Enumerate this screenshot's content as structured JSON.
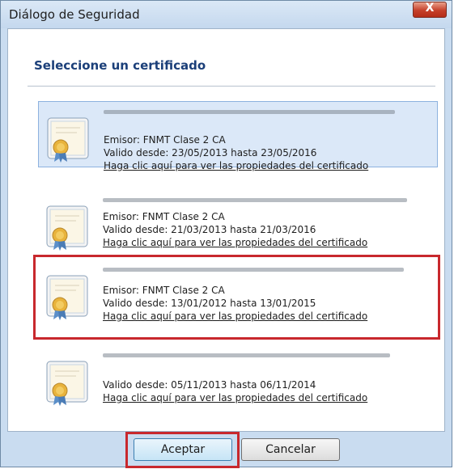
{
  "window": {
    "title": "Diálogo de Seguridad",
    "close_label": "X"
  },
  "header": {
    "title": "Seleccione un certificado"
  },
  "certificates": [
    {
      "issuer": "Emisor: FNMT Clase 2 CA",
      "validity": "Valido desde: 23/05/2013 hasta 23/05/2016",
      "link": "Haga clic aquí para ver las propiedades del certificado",
      "selected": true
    },
    {
      "issuer": "Emisor: FNMT Clase 2 CA",
      "validity": "Valido desde: 21/03/2013 hasta 21/03/2016",
      "link": "Haga clic aquí para ver las propiedades del certificado",
      "selected": false
    },
    {
      "issuer": "Emisor: FNMT Clase 2 CA",
      "validity": "Valido desde: 13/01/2012 hasta 13/01/2015",
      "link": "Haga clic aquí para ver las propiedades del certificado",
      "selected": false,
      "highlighted": true
    },
    {
      "validity": "Valido desde: 05/11/2013 hasta 06/11/2014",
      "link": "Haga clic aquí para ver las propiedades del certificado",
      "selected": false
    }
  ],
  "buttons": {
    "accept": "Aceptar",
    "cancel": "Cancelar"
  },
  "colors": {
    "annotation": "#c8282d",
    "header_text": "#1b3f79",
    "selection": "#dbe8f8"
  }
}
